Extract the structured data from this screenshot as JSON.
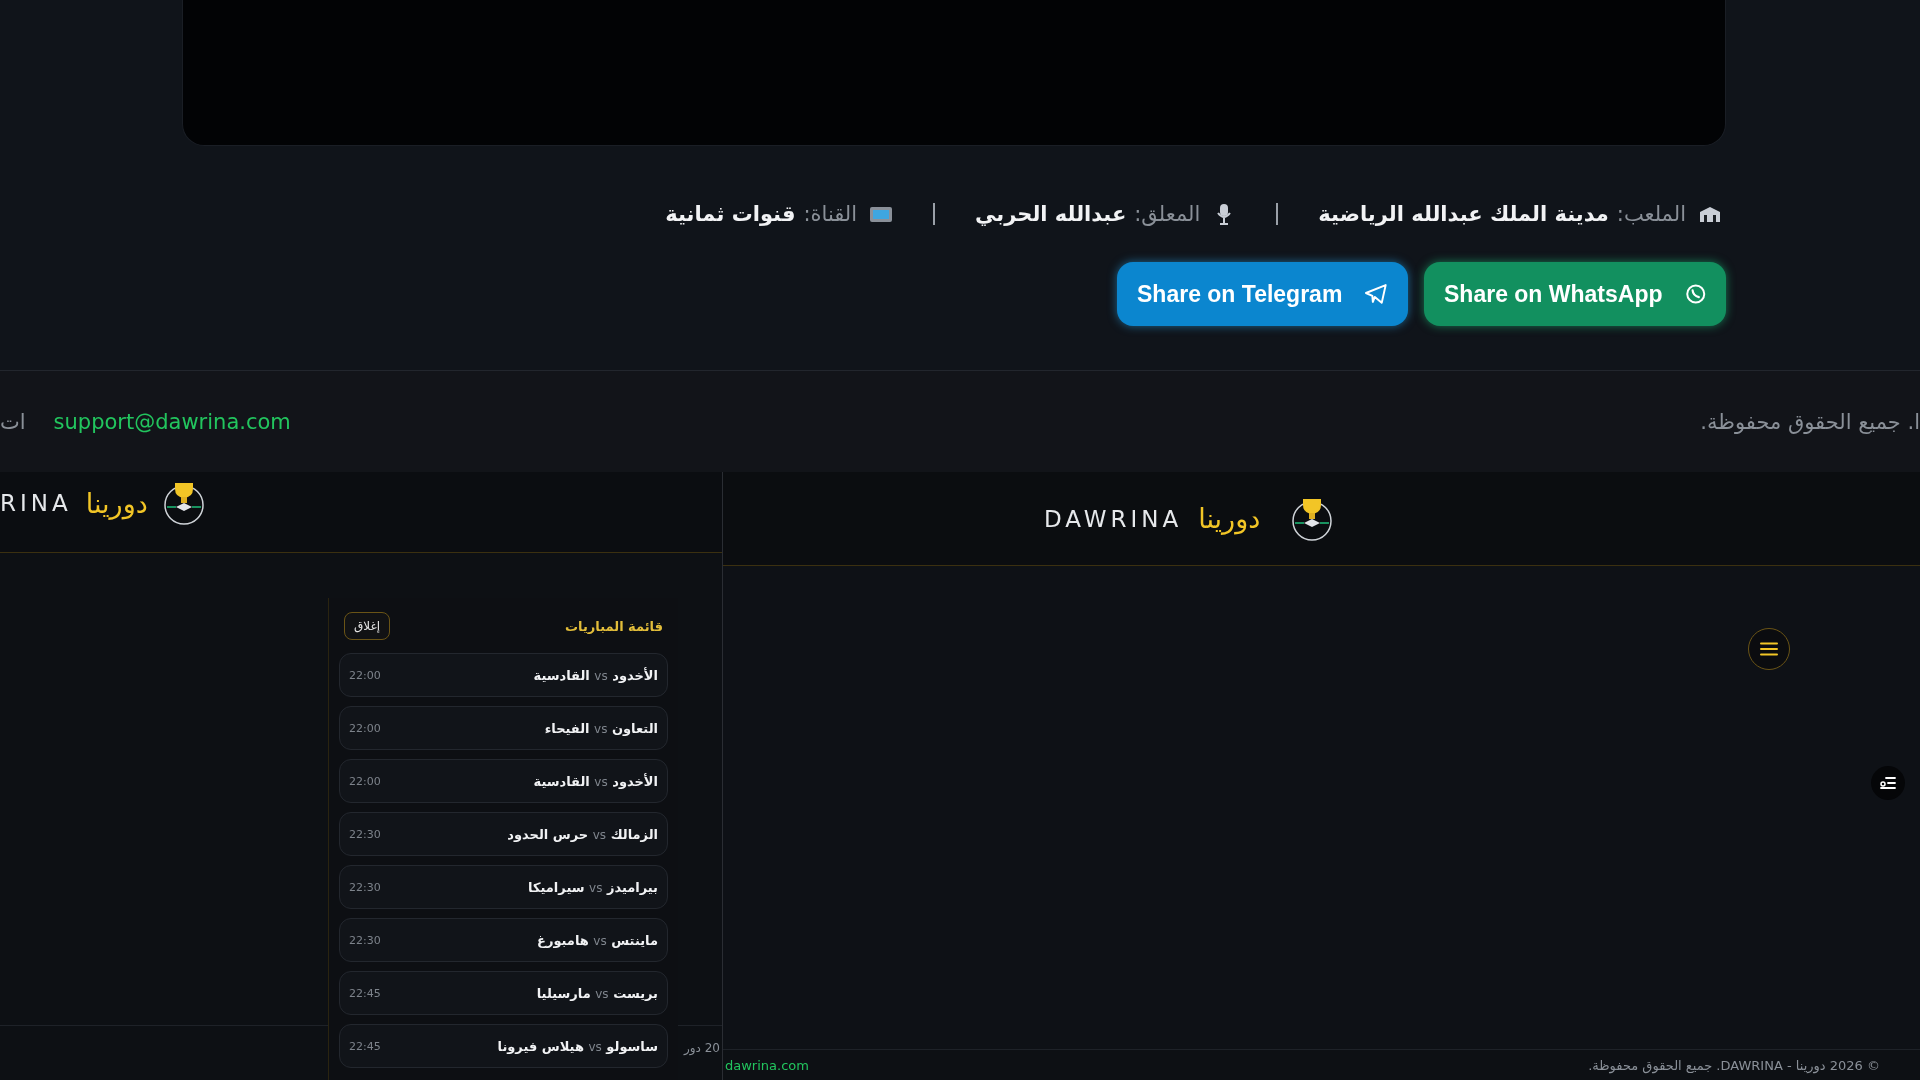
{
  "match_info": [
    {
      "kind": "stadium",
      "label": "الملعب:",
      "value": "مدينة الملك عبدالله الرياضية"
    },
    {
      "kind": "commentator",
      "label": "المعلق:",
      "value": "عبدالله الحربي"
    },
    {
      "kind": "channel",
      "label": "القناة:",
      "value": "قنوات ثمانية"
    }
  ],
  "share_buttons": [
    {
      "kind": "whatsapp",
      "label": "Share on WhatsApp"
    },
    {
      "kind": "telegram",
      "label": "Share on Telegram"
    }
  ],
  "footer": {
    "left_fragment": "ات",
    "email": "support@dawrina.com",
    "rights": "ا. جميع الحقوق محفوظة."
  },
  "left_panel": {
    "brand_latin": "RINA",
    "brand_arabic": "دورينا",
    "footer_fragment": "20 دور"
  },
  "match_list": {
    "title": "قائمة المباريات",
    "close": "إغلاق",
    "matches": [
      {
        "home": "الأخدود",
        "vs": "vs",
        "away": "القادسية",
        "time": "22:00"
      },
      {
        "home": "التعاون",
        "vs": "vs",
        "away": "الفيحاء",
        "time": "22:00"
      },
      {
        "home": "الأخدود",
        "vs": "vs",
        "away": "القادسية",
        "time": "22:00"
      },
      {
        "home": "الزمالك",
        "vs": "vs",
        "away": "حرس الحدود",
        "time": "22:30"
      },
      {
        "home": "بيراميدز",
        "vs": "vs",
        "away": "سيراميكا",
        "time": "22:30"
      },
      {
        "home": "ماينتس",
        "vs": "vs",
        "away": "هامبورغ",
        "time": "22:30"
      },
      {
        "home": "بريست",
        "vs": "vs",
        "away": "مارسيليا",
        "time": "22:45"
      },
      {
        "home": "ساسولو",
        "vs": "vs",
        "away": "هيلاس فيرونا",
        "time": "22:45"
      }
    ]
  },
  "right_panel": {
    "brand_latin": "DAWRINA",
    "brand_arabic": "دورينا",
    "footer_link": "dawrina.com",
    "copyright": "© 2026 دورينا - DAWRINA. جميع الحقوق محفوظة."
  }
}
